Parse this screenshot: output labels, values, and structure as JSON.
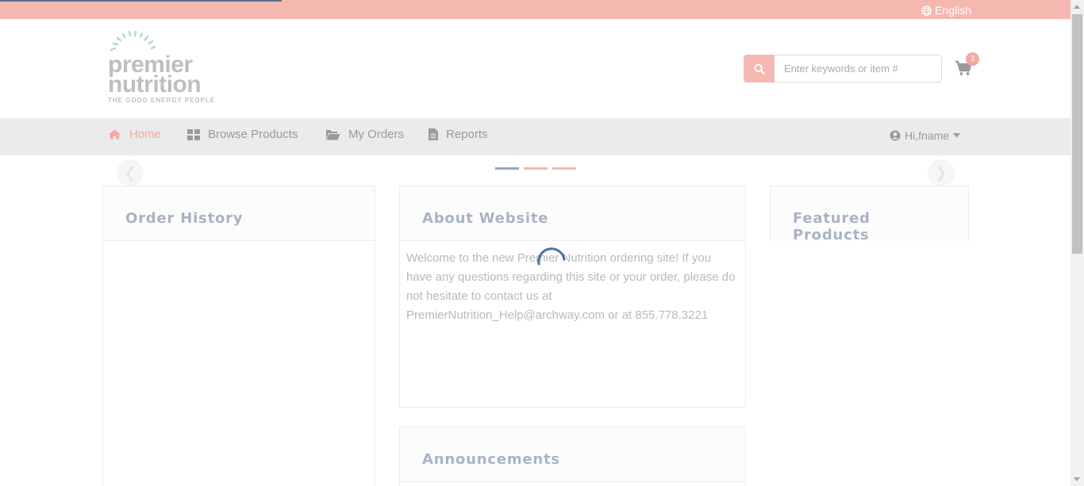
{
  "topbar": {
    "language_label": "English"
  },
  "logo": {
    "line1": "premier",
    "line2": "nutrition",
    "tagline": "THE GOOD ENERGY PEOPLE"
  },
  "search": {
    "placeholder": "Enter keywords or item #"
  },
  "cart": {
    "count": "3"
  },
  "nav": {
    "items": [
      {
        "label": "Home",
        "icon": "home-icon",
        "active": true
      },
      {
        "label": "Browse Products",
        "icon": "grid-icon"
      },
      {
        "label": "My Orders",
        "icon": "folder-open-icon"
      },
      {
        "label": "Reports",
        "icon": "file-icon"
      }
    ],
    "user_greeting": "Hi,fname"
  },
  "panels": {
    "order_history": {
      "title": "Order History"
    },
    "about": {
      "title": "About Website",
      "text": "Welcome to the new Premier Nutrition ordering site! If you have any questions regarding this site or your order, please do not hesitate to contact us at PremierNutrition_Help@archway.com or at 855.778.3221"
    },
    "featured": {
      "title": "Featured Products"
    },
    "announcements": {
      "title": "Announcements"
    }
  },
  "colors": {
    "accent": "#f4b8b1",
    "indicator_active": "#9aa9c0",
    "indicator_inactive": "#f4b8b1",
    "spinner": "#1f4e8c"
  }
}
